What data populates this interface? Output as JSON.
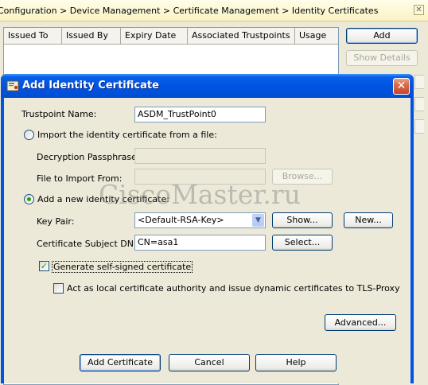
{
  "breadcrumb": "Configuration > Device Management > Certificate Management > Identity Certificates",
  "table": {
    "columns": [
      "Issued To",
      "Issued By",
      "Expiry Date",
      "Associated Trustpoints",
      "Usage"
    ]
  },
  "side_buttons": {
    "add": "Add",
    "show_details": "Show Details"
  },
  "dialog": {
    "title": "Add Identity Certificate",
    "trustpoint_label": "Trustpoint Name:",
    "trustpoint_value": "ASDM_TrustPoint0",
    "import_radio": "Import the identity certificate from a file:",
    "passphrase_label": "Decryption Passphrase:",
    "file_label": "File to Import From:",
    "browse_button": "Browse...",
    "new_radio": "Add a new identity certificate:",
    "keypair_label": "Key Pair:",
    "keypair_value": "<Default-RSA-Key>",
    "show_button": "Show...",
    "new_button": "New...",
    "subject_label": "Certificate Subject DN:",
    "subject_value": "CN=asa1",
    "select_button": "Select...",
    "self_signed_check": "Generate self-signed certificate",
    "self_signed_checked": true,
    "local_ca_check": "Act as local certificate authority and issue dynamic certificates to TLS-Proxy",
    "local_ca_checked": false,
    "advanced_button": "Advanced...",
    "add_certificate_button": "Add Certificate",
    "cancel_button": "Cancel",
    "help_button": "Help"
  },
  "watermark": "CiscoMaster.ru"
}
